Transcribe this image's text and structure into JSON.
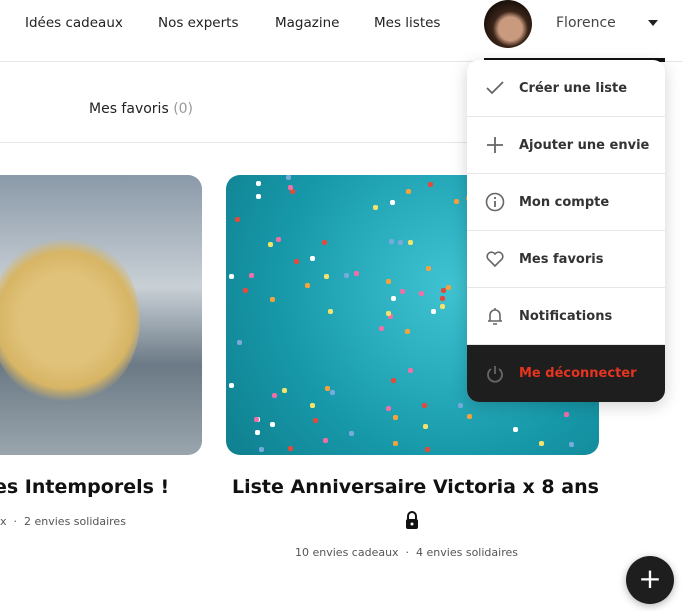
{
  "nav": {
    "items": [
      "Idées cadeaux",
      "Nos experts",
      "Magazine",
      "Mes listes"
    ],
    "user": "Florence"
  },
  "subtab": {
    "label": "Mes favoris",
    "count": "(0)"
  },
  "cards": [
    {
      "title": "es Intemporels !",
      "meta1": "x",
      "meta2": "2 envies solidaires"
    },
    {
      "title": "Liste Anniversaire Victoria x 8 ans",
      "meta1": "10 envies cadeaux",
      "meta2": "4 envies solidaires",
      "private": true
    }
  ],
  "menu": {
    "items": [
      {
        "label": "Créer une liste",
        "icon": "check-icon"
      },
      {
        "label": "Ajouter une envie",
        "icon": "plus-icon"
      },
      {
        "label": "Mon compte",
        "icon": "info-icon"
      },
      {
        "label": "Mes favoris",
        "icon": "heart-icon"
      },
      {
        "label": "Notifications",
        "icon": "bell-icon"
      },
      {
        "label": "Me déconnecter",
        "icon": "power-icon"
      }
    ]
  },
  "fab": "+",
  "colors": {
    "logout": "#e5341f",
    "dark": "#1e1e1e"
  }
}
